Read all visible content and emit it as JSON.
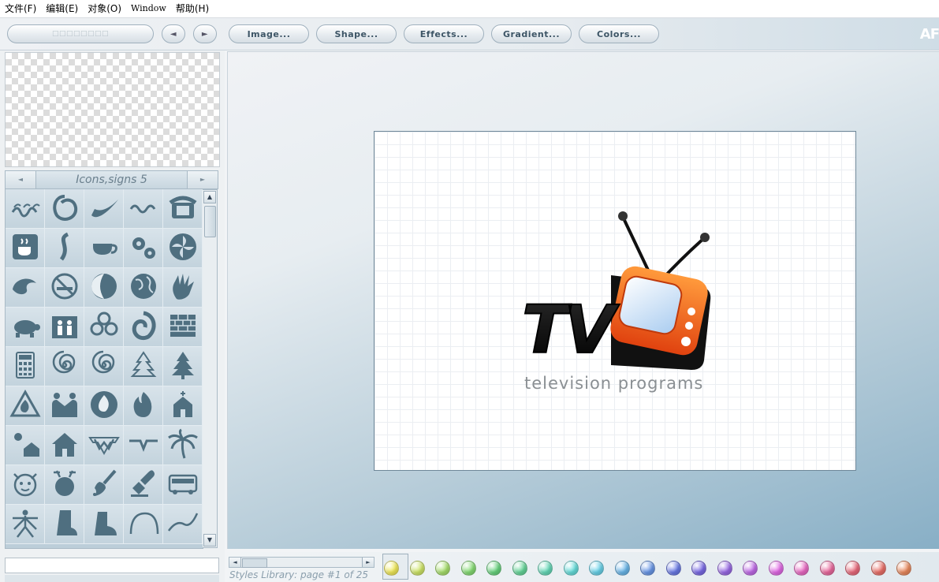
{
  "menu": {
    "items": [
      "文件(F)",
      "编辑(E)",
      "对象(O)",
      "Window",
      "帮助(H)"
    ]
  },
  "toolbar": {
    "search_placeholder": "□□□□□□□□",
    "prev_label": "◄",
    "next_label": "►",
    "image_label": "Image...",
    "shape_label": "Shape...",
    "effects_label": "Effects...",
    "gradient_label": "Gradient...",
    "colors_label": "Colors...",
    "brand_text": "AF"
  },
  "library": {
    "title": "Icons,signs 5",
    "prev_arrow": "◄",
    "next_arrow": "►",
    "icons": [
      "waves-curl-icon",
      "swirl-icon",
      "swoosh-icon",
      "squiggle-icon",
      "telephone-icon",
      "coffee-cup-sign-icon",
      "s-curve-icon",
      "teacup-icon",
      "gears-icon",
      "pinwheel-icon",
      "wave-curl-icon",
      "no-smoking-icon",
      "moon-phase-icon",
      "globe-icon",
      "hand-print-icon",
      "turtle-icon",
      "family-icon",
      "clover-icon",
      "feather-spiral-icon",
      "brick-wall-icon",
      "calculator-icon",
      "spiral-icon",
      "spiral-icon",
      "xmas-tree-outline-icon",
      "xmas-tree-icon",
      "fire-warning-icon",
      "handshake-icon",
      "fire-circle-icon",
      "flame-icon",
      "church-icon",
      "sun-house-icon",
      "house-icon",
      "wonder-woman-logo-icon",
      "wings-logo-icon",
      "palm-tree-icon",
      "female-face-icon",
      "male-sign-icon",
      "paint-brush-icon",
      "stamp-icon",
      "bus-icon",
      "vitruvian-icon",
      "boot-icon",
      "shoe-icon",
      "arc-icon",
      "swoop-icon"
    ],
    "scroll_up": "▲",
    "scroll_down": "▼"
  },
  "canvas": {
    "logo_letters": "TV",
    "tagline": "television programs"
  },
  "bottom": {
    "styles_label": "Styles Library: page #1 of 25",
    "scroll_left": "◄",
    "scroll_right": "►",
    "swatch_colors": [
      "#f1ea5a",
      "#cfe668",
      "#a8e06c",
      "#86dc74",
      "#68d47e",
      "#66d79a",
      "#66dab9",
      "#66dedb",
      "#6ad3ea",
      "#6ab7ea",
      "#6a98e8",
      "#6a7ae6",
      "#7a6ae6",
      "#9a6ae6",
      "#c06ae8",
      "#e26ae6",
      "#ea6ac4",
      "#ea6a9e",
      "#ea6a7c",
      "#ea7068",
      "#ea8a5e"
    ]
  }
}
